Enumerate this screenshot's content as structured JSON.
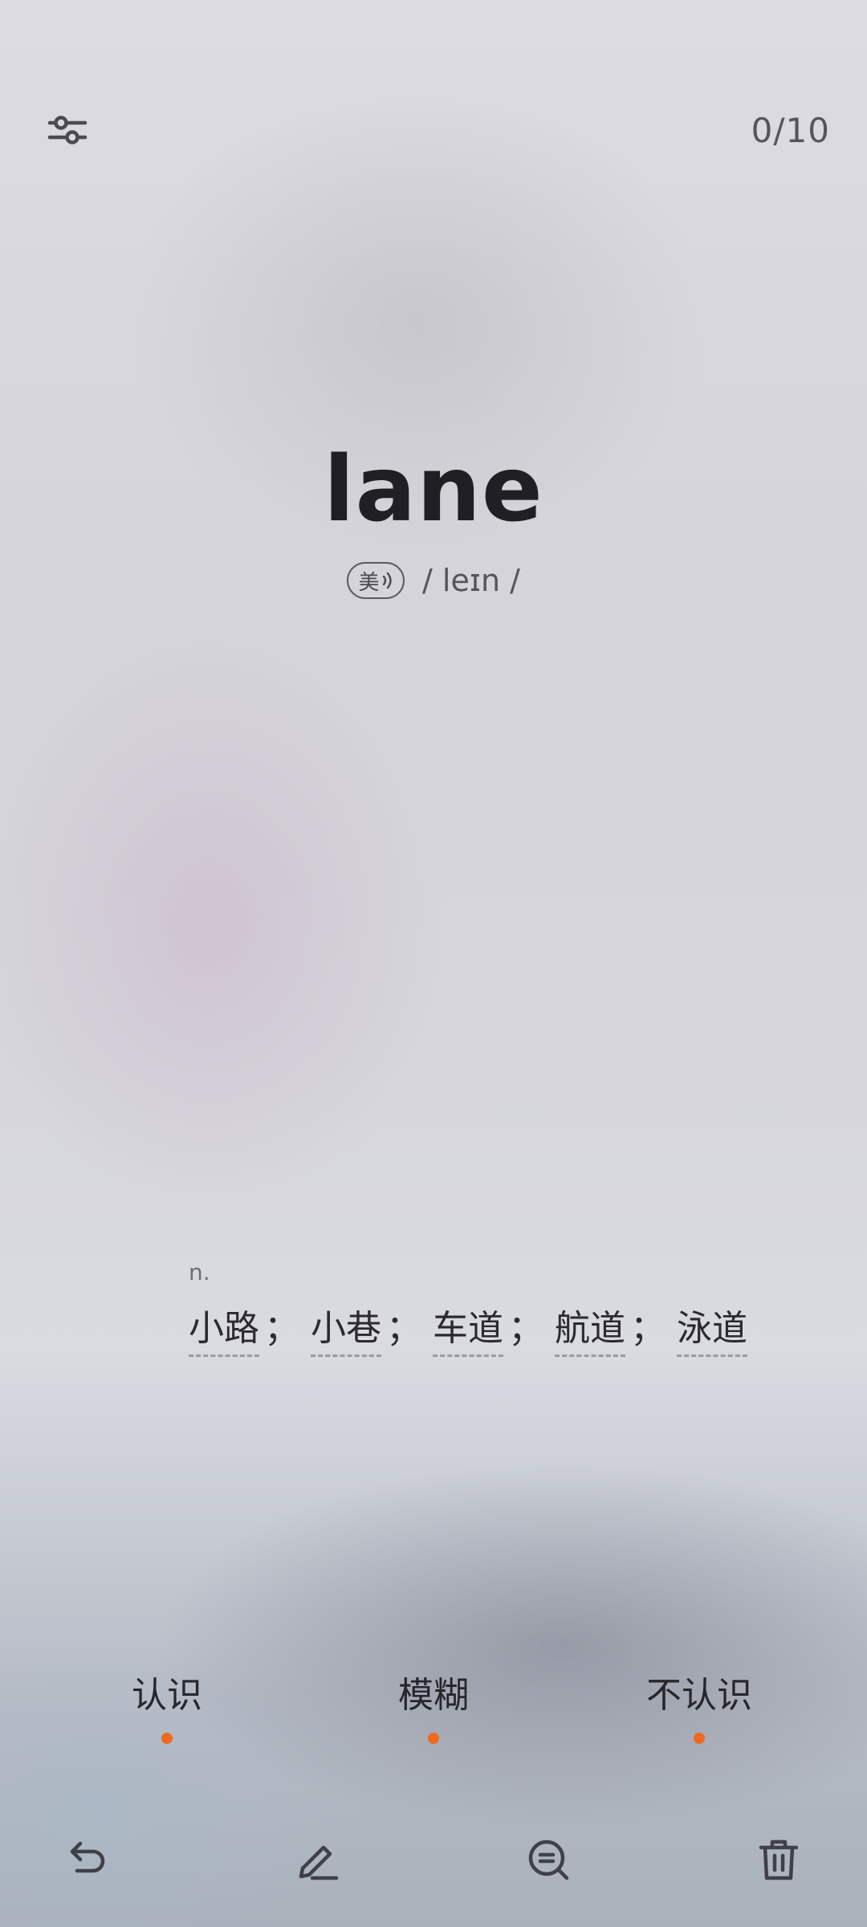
{
  "header": {
    "filter_icon": "sliders-icon",
    "counter": "0/10"
  },
  "word": {
    "text": "lane",
    "accent_label": "美",
    "phonetic": "/ leɪn /"
  },
  "definition": {
    "pos": "n.",
    "meanings": [
      "小路",
      "小巷",
      "车道",
      "航道",
      "泳道"
    ],
    "separator": "；"
  },
  "ratings": [
    {
      "label": "认识",
      "dot_color": "#ee6a1f"
    },
    {
      "label": "模糊",
      "dot_color": "#ee6a1f"
    },
    {
      "label": "不认识",
      "dot_color": "#ee6a1f"
    }
  ],
  "toolbar": {
    "icons": [
      "undo-icon",
      "edit-icon",
      "search-detail-icon",
      "trash-icon"
    ]
  }
}
